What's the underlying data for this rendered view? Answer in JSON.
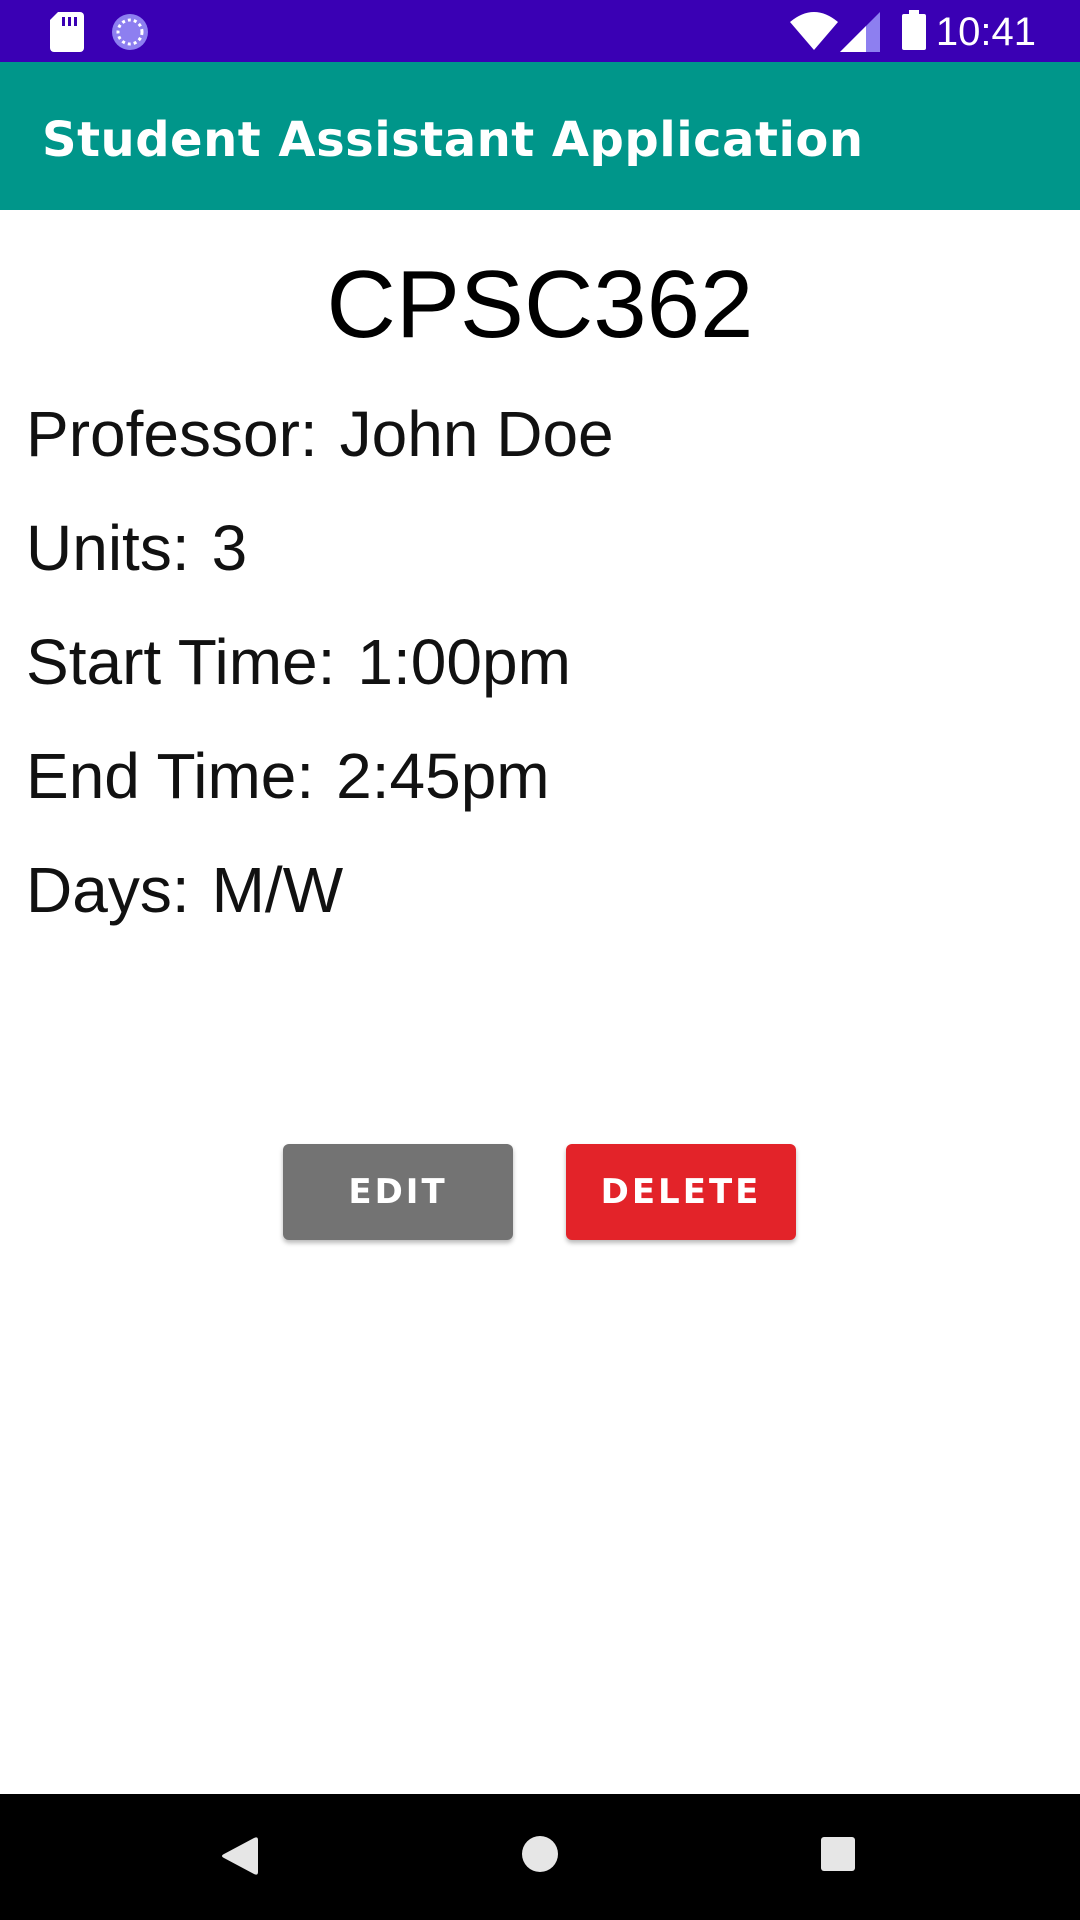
{
  "status_bar": {
    "time": "10:41",
    "icons": [
      "sd-card-icon",
      "sync-icon",
      "wifi-icon",
      "signal-icon",
      "battery-icon"
    ],
    "background": "#3a00b4"
  },
  "app_bar": {
    "title": "Student Assistant Application",
    "background": "#00968a"
  },
  "course": {
    "code": "CPSC362",
    "professor_label": "Professor:",
    "professor_value": "John Doe",
    "units_label": "Units:",
    "units_value": "3",
    "start_label": "Start Time:",
    "start_value": "1:00pm",
    "end_label": "End Time:",
    "end_value": "2:45pm",
    "days_label": "Days:",
    "days_value": "M/W"
  },
  "actions": {
    "edit_label": "EDIT",
    "delete_label": "DELETE",
    "edit_color": "#737373",
    "delete_color": "#e32329"
  },
  "nav_bar": {
    "icons": [
      "back-icon",
      "home-icon",
      "recents-icon"
    ]
  }
}
